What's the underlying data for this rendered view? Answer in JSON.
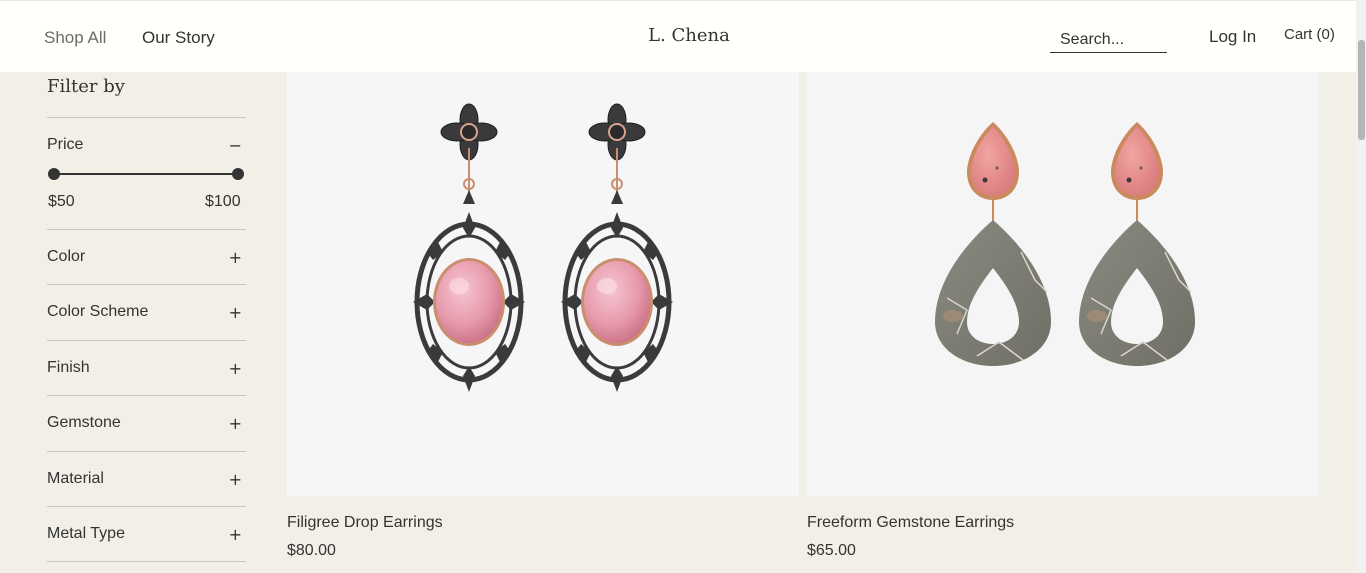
{
  "header": {
    "nav": [
      "Shop All",
      "Our Story"
    ],
    "brand": "L. Chena",
    "search_placeholder": "Search...",
    "login": "Log In",
    "cart": "Cart (0)"
  },
  "sidebar": {
    "title": "Filter by",
    "price": {
      "label": "Price",
      "toggle": "−",
      "min": "$50",
      "max": "$100"
    },
    "filters": [
      {
        "label": "Color",
        "toggle": "+"
      },
      {
        "label": "Color Scheme",
        "toggle": "+"
      },
      {
        "label": "Finish",
        "toggle": "+"
      },
      {
        "label": "Gemstone",
        "toggle": "+"
      },
      {
        "label": "Material",
        "toggle": "+"
      },
      {
        "label": "Metal Type",
        "toggle": "+"
      }
    ]
  },
  "products": [
    {
      "name": "Filigree Drop Earrings",
      "price": "$80.00"
    },
    {
      "name": "Freeform Gemstone Earrings",
      "price": "$65.00"
    }
  ],
  "colors": {
    "background": "#f1efe6",
    "header": "#fffffb",
    "text": "#333333"
  }
}
